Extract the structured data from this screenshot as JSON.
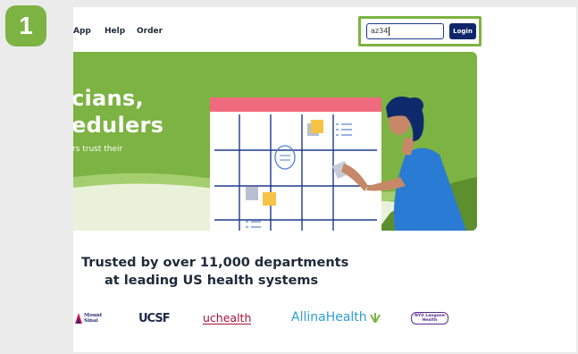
{
  "step": {
    "number": "1"
  },
  "nav": {
    "items": [
      "App",
      "Help",
      "Order"
    ]
  },
  "login": {
    "input_value": "az34",
    "button_label": "Login"
  },
  "hero": {
    "headline_line1": "cians,",
    "headline_line2": "edulers",
    "subtext": "rs trust their"
  },
  "trusted": {
    "line1": "Trusted by over 11,000 departments",
    "line2": "at leading US health systems"
  },
  "logos": {
    "mount_sinai_line1": "Mount",
    "mount_sinai_line2": "Sinai",
    "ucsf": "UCSF",
    "uchealth": "uchealth",
    "allina": "AllinaHealth",
    "nyu_line1": "NYU Langone",
    "nyu_line2": "Health"
  },
  "colors": {
    "accent_green": "#7cb342",
    "navy": "#10266b",
    "pink_bar": "#f06a7d",
    "grid_blue": "#1e3a8a"
  }
}
